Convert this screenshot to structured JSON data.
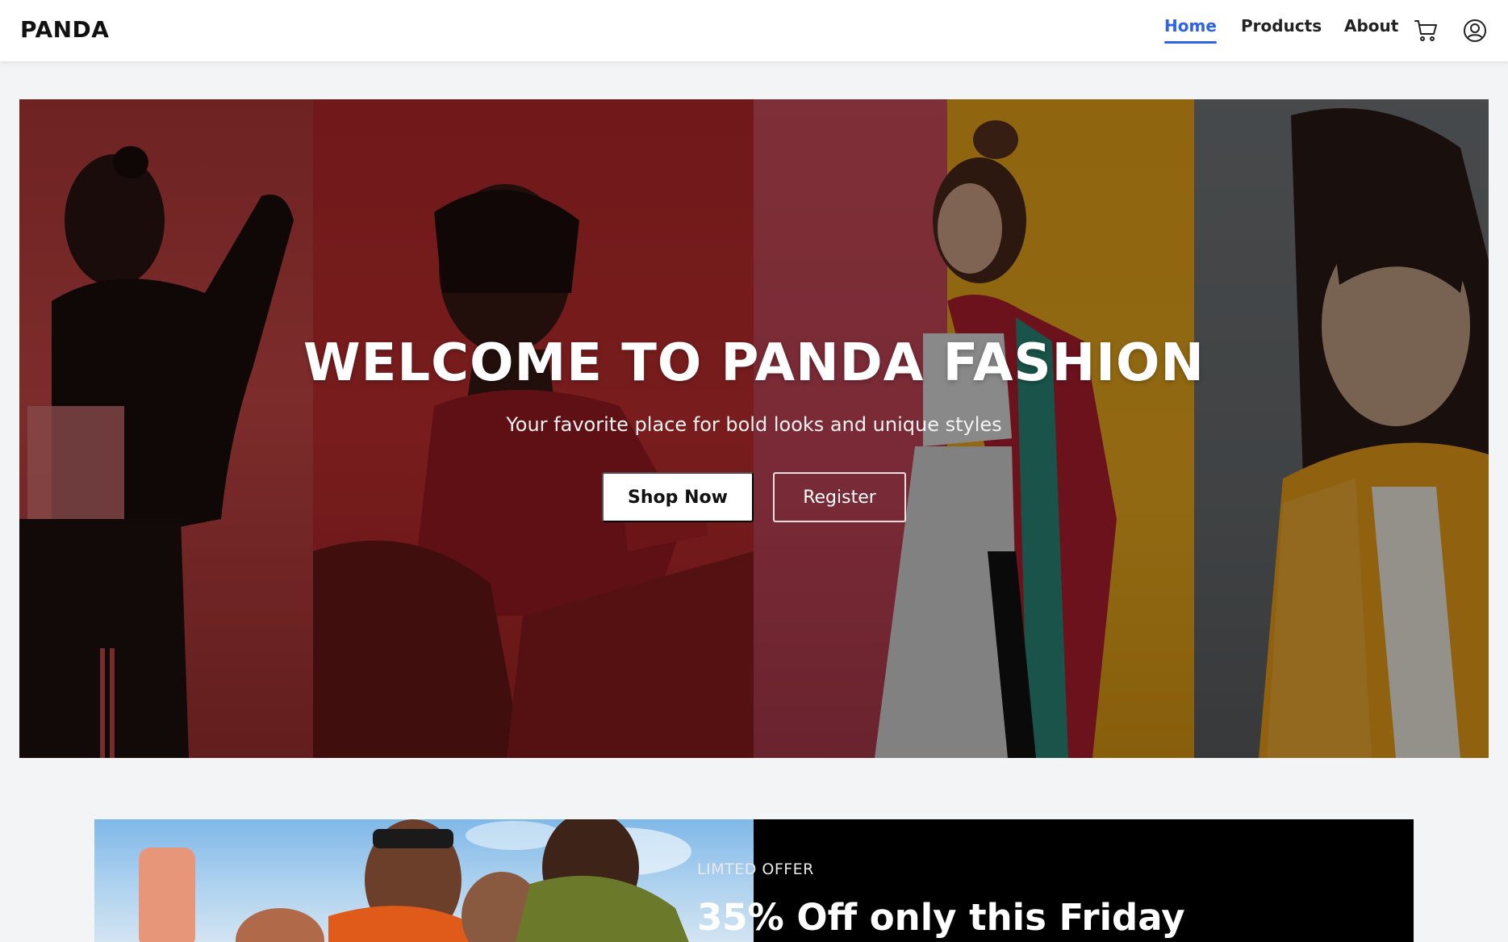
{
  "header": {
    "logo": "PANDA",
    "nav": [
      {
        "label": "Home",
        "active": true
      },
      {
        "label": "Products",
        "active": false
      },
      {
        "label": "About",
        "active": false
      }
    ],
    "icons": [
      "cart-icon",
      "user-circle-icon"
    ],
    "accent_color": "#2f63e6"
  },
  "hero": {
    "title": "WELCOME TO PANDA FASHION",
    "subtitle": "Your favorite place for bold looks and unique styles",
    "primary_button": "Shop Now",
    "secondary_button": "Register",
    "panel_colors": [
      "#c04040",
      "#c62d2f",
      "#cf4b5a",
      "#f0a81a",
      "#717578"
    ]
  },
  "offer": {
    "kicker": "LIMTED OFFER",
    "headline": "35% Off only this Friday"
  }
}
